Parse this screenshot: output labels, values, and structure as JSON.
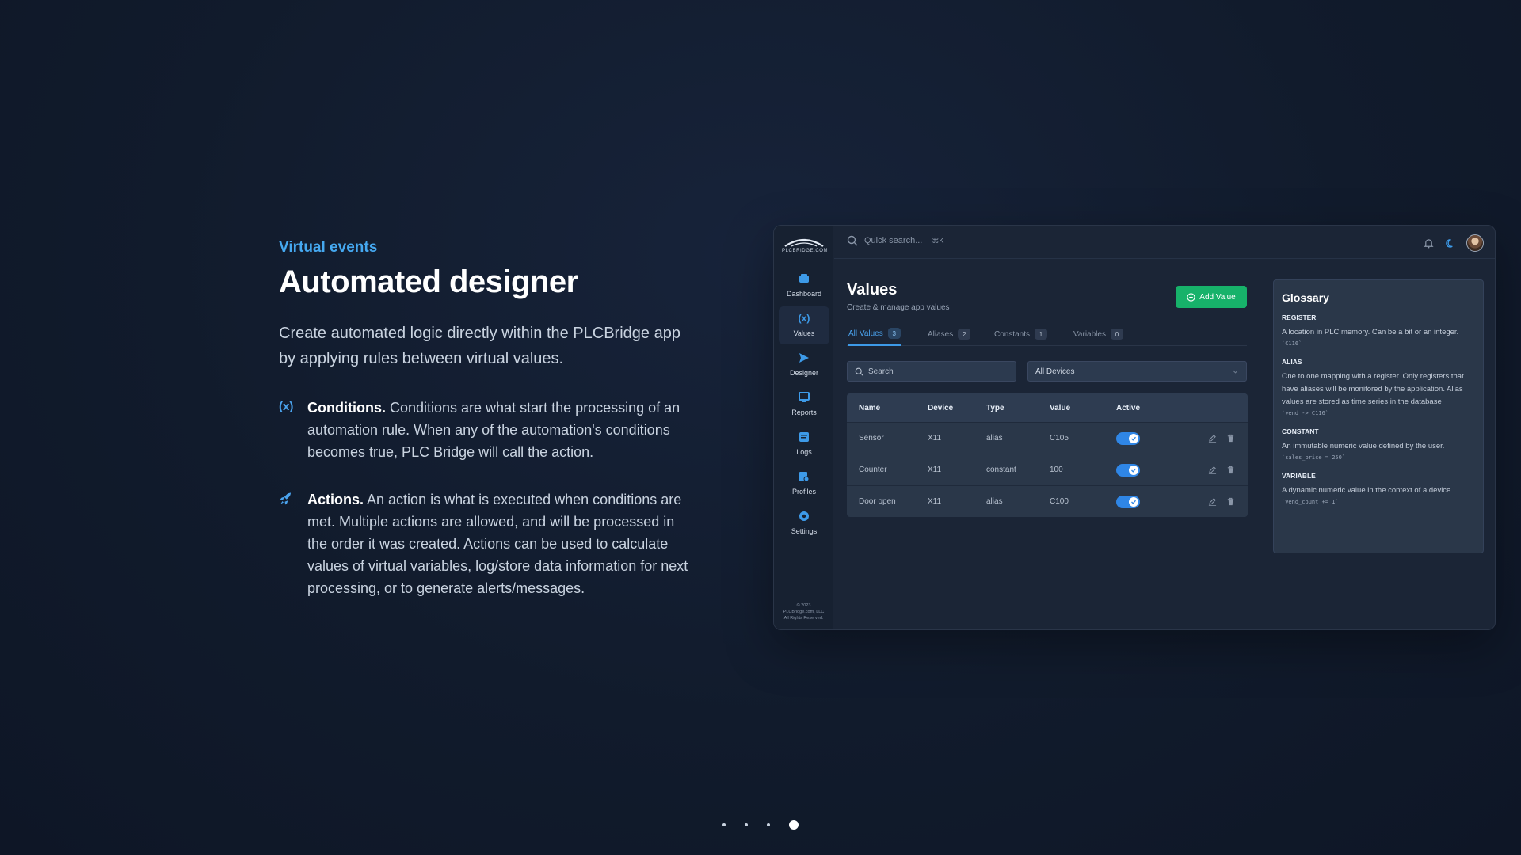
{
  "hero": {
    "eyebrow": "Virtual events",
    "title": "Automated designer",
    "lead": "Create automated logic directly within the PLCBridge app by applying rules between virtual values.",
    "features": [
      {
        "icon": "variable-x-icon",
        "title": "Conditions.",
        "text": " Conditions are what start the processing of an automation rule. When any of the automation's conditions becomes true, PLC Bridge will call the action."
      },
      {
        "icon": "rocket-icon",
        "title": "Actions.",
        "text": " An action is what is executed when conditions are met. Multiple actions are allowed, and will be processed in the order it was created. Actions can be used to calculate values of virtual variables, log/store data information for next processing, or to generate alerts/messages."
      }
    ]
  },
  "app": {
    "logo_text": "PLCBRIDGE.COM",
    "nav": [
      {
        "label": "Dashboard",
        "icon": "dashboard-icon"
      },
      {
        "label": "Values",
        "icon": "variable-x-icon"
      },
      {
        "label": "Designer",
        "icon": "send-icon"
      },
      {
        "label": "Reports",
        "icon": "monitor-icon"
      },
      {
        "label": "Logs",
        "icon": "log-icon"
      },
      {
        "label": "Profiles",
        "icon": "profile-icon"
      },
      {
        "label": "Settings",
        "icon": "gear-icon"
      }
    ],
    "copyright": [
      "© 2023",
      "PLCBridge.com, LLC",
      "All Rights Reserved."
    ],
    "topbar": {
      "search_placeholder": "Quick search...",
      "shortcut": "⌘K"
    },
    "page": {
      "title": "Values",
      "subtitle": "Create & manage app values",
      "add_label": "Add Value"
    },
    "tabs": [
      {
        "label": "All Values",
        "count": "3"
      },
      {
        "label": "Aliases",
        "count": "2"
      },
      {
        "label": "Constants",
        "count": "1"
      },
      {
        "label": "Variables",
        "count": "0"
      }
    ],
    "filters": {
      "search_placeholder": "Search",
      "device_selected": "All Devices"
    },
    "table": {
      "headers": [
        "Name",
        "Device",
        "Type",
        "Value",
        "Active"
      ],
      "rows": [
        {
          "name": "Sensor",
          "device": "X11",
          "type": "alias",
          "value": "C105"
        },
        {
          "name": "Counter",
          "device": "X11",
          "type": "constant",
          "value": "100"
        },
        {
          "name": "Door open",
          "device": "X11",
          "type": "alias",
          "value": "C100"
        }
      ]
    },
    "glossary": {
      "title": "Glossary",
      "entries": [
        {
          "term": "REGISTER",
          "desc": "A location in PLC memory. Can be a bit or an integer.",
          "code": "`C116`"
        },
        {
          "term": "ALIAS",
          "desc": "One to one mapping with a register. Only registers that have aliases will be monitored by the application. Alias values are stored as time series in the database",
          "code": "`vend -> C116`"
        },
        {
          "term": "CONSTANT",
          "desc": "An immutable numeric value defined by the user.",
          "code": "`sales_price = 250`"
        },
        {
          "term": "VARIABLE",
          "desc": "A dynamic numeric value in the context of a device.",
          "code": "`vend_count += 1`"
        }
      ]
    }
  },
  "colors": {
    "accent": "#3d9ae8",
    "success": "#17b26a",
    "background": "#111b2c"
  }
}
